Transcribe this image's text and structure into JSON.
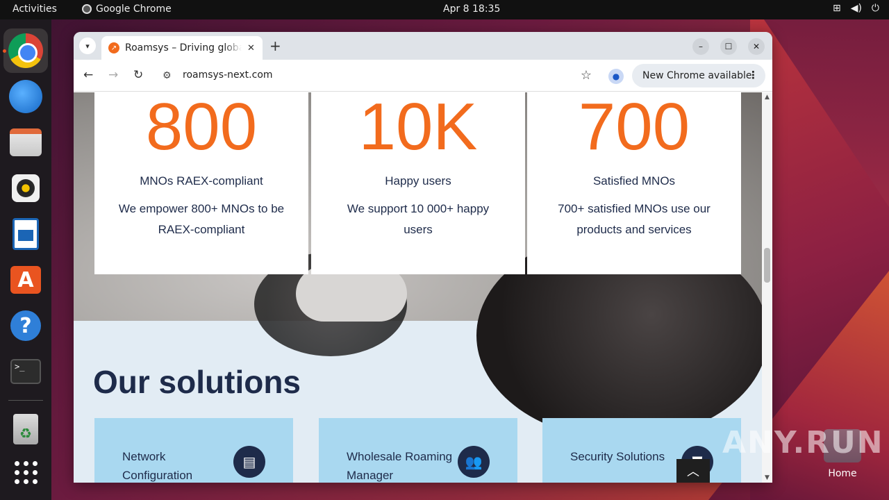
{
  "topbar": {
    "activities": "Activities",
    "app_name": "Google Chrome",
    "clock": "Apr 8  18:35",
    "tray_icons": [
      "network-icon",
      "volume-icon",
      "power-icon"
    ]
  },
  "dock": {
    "items": [
      "chrome",
      "thunderbird",
      "files",
      "rhythmbox",
      "libreoffice-writer",
      "app-center",
      "help",
      "terminal",
      "trash",
      "show-apps"
    ]
  },
  "desktop": {
    "home_label": "Home",
    "watermark": "ANY.RUN"
  },
  "browser": {
    "tab_title": "Roamsys – Driving global",
    "new_tab": "+",
    "url": "roamsys-next.com",
    "update_label": "New Chrome available"
  },
  "page": {
    "stats": [
      {
        "number": "800",
        "label": "MNOs RAEX-compliant",
        "desc": "We empower 800+ MNOs to be RAEX-compliant"
      },
      {
        "number": "10K",
        "label": "Happy users",
        "desc": "We support 10 000+ happy users"
      },
      {
        "number": "700",
        "label": "Satisfied MNOs",
        "desc": "700+ satisfied MNOs use our products and services"
      }
    ],
    "solutions_title": "Our solutions",
    "solutions": [
      {
        "label": "Network Configuration",
        "icon": "server-icon"
      },
      {
        "label": "Wholesale Roaming Manager",
        "icon": "users-icon"
      },
      {
        "label": "Security Solutions",
        "icon": "shield-icon"
      }
    ]
  },
  "colors": {
    "accent": "#f26b1d",
    "navy": "#1e2b4a",
    "card_blue": "#a9d8f0",
    "section_bg": "#e2ecf4"
  }
}
